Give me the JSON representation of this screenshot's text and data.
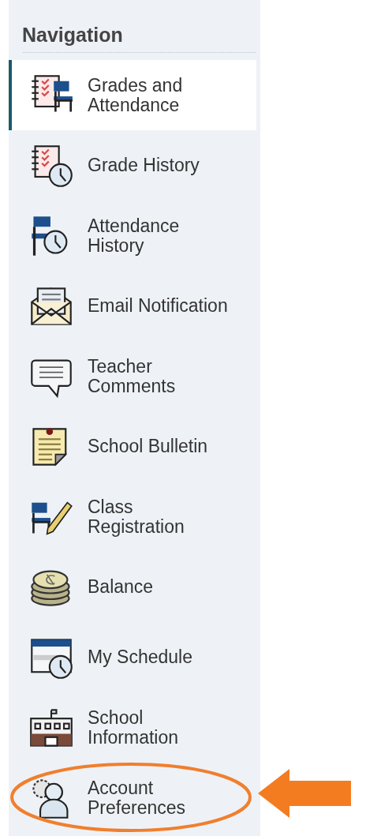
{
  "navigation": {
    "title": "Navigation",
    "items": [
      {
        "label": "Grades and Attendance",
        "kind": "grades",
        "selected": true,
        "highlighted": false
      },
      {
        "label": "Grade History",
        "kind": "grade-history",
        "selected": false,
        "highlighted": false
      },
      {
        "label": "Attendance History",
        "kind": "attendance-history",
        "selected": false,
        "highlighted": false
      },
      {
        "label": "Email Notification",
        "kind": "email",
        "selected": false,
        "highlighted": false
      },
      {
        "label": "Teacher Comments",
        "kind": "comments",
        "selected": false,
        "highlighted": false
      },
      {
        "label": "School Bulletin",
        "kind": "bulletin",
        "selected": false,
        "highlighted": false
      },
      {
        "label": "Class Registration",
        "kind": "registration",
        "selected": false,
        "highlighted": false
      },
      {
        "label": "Balance",
        "kind": "balance",
        "selected": false,
        "highlighted": false
      },
      {
        "label": "My Schedule",
        "kind": "schedule",
        "selected": false,
        "highlighted": false
      },
      {
        "label": "School Information",
        "kind": "school",
        "selected": false,
        "highlighted": false
      },
      {
        "label": "Account Preferences",
        "kind": "account",
        "selected": false,
        "highlighted": true
      }
    ]
  }
}
